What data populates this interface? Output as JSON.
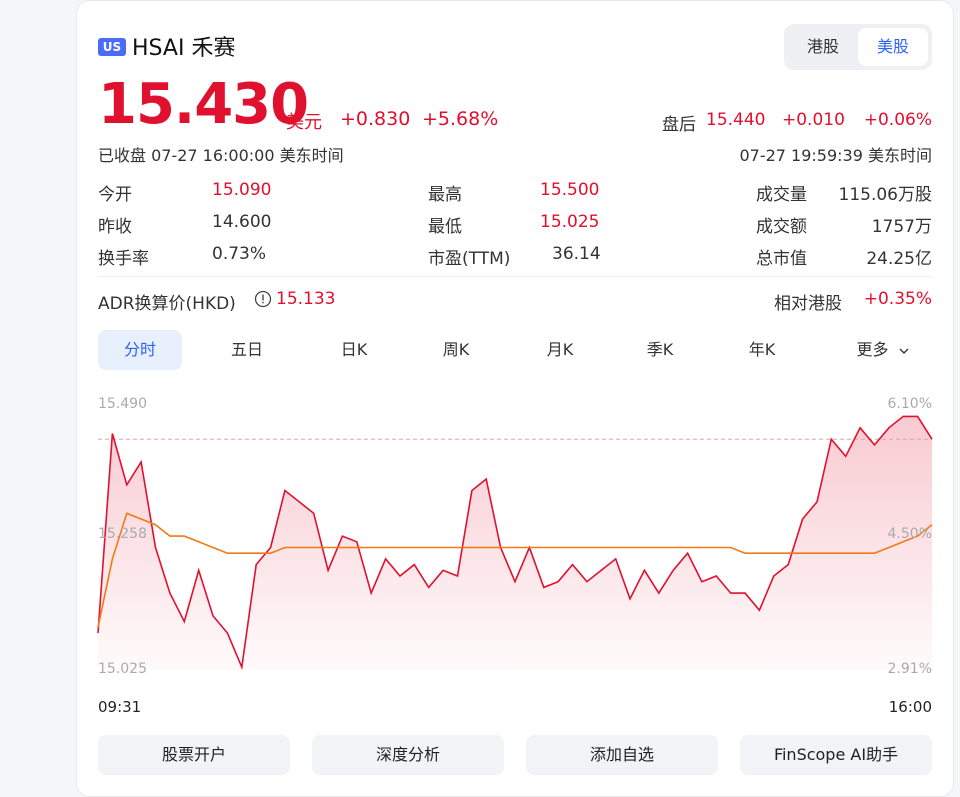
{
  "header": {
    "badge": "US",
    "title": "HSAI 禾赛",
    "market_hk": "港股",
    "market_us": "美股"
  },
  "quote": {
    "price": "15.430",
    "currency": "美元",
    "change": "+0.830",
    "change_pct": "+5.68%",
    "status": "已收盘 07-27 16:00:00 美东时间",
    "after_label": "盘后",
    "after_price": "15.440",
    "after_change": "+0.010",
    "after_pct": "+0.06%",
    "after_time": "07-27 19:59:39 美东时间"
  },
  "stats": {
    "open_label": "今开",
    "open": "15.090",
    "prev_label": "昨收",
    "prev": "14.600",
    "turnover_label": "换手率",
    "turnover": "0.73%",
    "high_label": "最高",
    "high": "15.500",
    "low_label": "最低",
    "low": "15.025",
    "pe_label": "市盈(TTM)",
    "pe": "36.14",
    "volume_label": "成交量",
    "volume": "115.06万股",
    "amount_label": "成交额",
    "amount": "1757万",
    "mcap_label": "总市值",
    "mcap": "24.25亿"
  },
  "adr": {
    "label": "ADR换算价(HKD)",
    "info_icon": "info-circle-icon",
    "value": "15.133",
    "rel_label": "相对港股",
    "rel_value": "+0.35%"
  },
  "tabs": [
    "分时",
    "五日",
    "日K",
    "周K",
    "月K",
    "季K",
    "年K",
    "更多"
  ],
  "actions": [
    "股票开户",
    "深度分析",
    "添加自选",
    "FinScope AI助手"
  ],
  "colors": {
    "up": "#e0102f",
    "avg_line": "#f07a14",
    "accent": "#2f63ff",
    "badge": "#4a6cf7"
  },
  "chart_data": {
    "type": "line",
    "y_left_ticks": [
      "15.490",
      "15.258",
      "15.025"
    ],
    "y_right_ticks": [
      "6.10%",
      "4.50%",
      "2.91%"
    ],
    "x_ticks": [
      "09:31",
      "16:00"
    ],
    "ylim": [
      15.025,
      15.49
    ],
    "reference_line": 15.43,
    "x": [
      "09:31",
      "09:37",
      "09:44",
      "09:51",
      "09:58",
      "10:04",
      "10:11",
      "10:18",
      "10:24",
      "10:31",
      "10:38",
      "10:45",
      "10:51",
      "10:58",
      "11:05",
      "11:11",
      "11:18",
      "11:25",
      "11:31",
      "11:38",
      "11:45",
      "11:52",
      "11:58",
      "12:05",
      "12:12",
      "12:18",
      "12:25",
      "12:32",
      "12:38",
      "12:45",
      "12:52",
      "12:59",
      "13:05",
      "13:12",
      "13:19",
      "13:25",
      "13:32",
      "13:39",
      "13:45",
      "13:52",
      "13:59",
      "14:06",
      "14:12",
      "14:19",
      "14:26",
      "14:32",
      "14:39",
      "14:46",
      "14:52",
      "14:59",
      "15:06",
      "15:13",
      "15:19",
      "15:26",
      "15:33",
      "15:39",
      "15:46",
      "15:53",
      "16:00"
    ],
    "series": [
      {
        "values": [
          15.09,
          15.44,
          15.35,
          15.39,
          15.24,
          15.16,
          15.11,
          15.2,
          15.12,
          15.09,
          15.03,
          15.21,
          15.24,
          15.34,
          15.32,
          15.3,
          15.2,
          15.26,
          15.25,
          15.16,
          15.22,
          15.19,
          15.21,
          15.17,
          15.2,
          15.19,
          15.34,
          15.36,
          15.24,
          15.18,
          15.24,
          15.17,
          15.18,
          15.21,
          15.18,
          15.2,
          15.22,
          15.15,
          15.2,
          15.16,
          15.2,
          15.23,
          15.18,
          15.19,
          15.16,
          15.16,
          15.13,
          15.19,
          15.21,
          15.29,
          15.32,
          15.43,
          15.4,
          15.45,
          15.42,
          15.45,
          15.47,
          15.47,
          15.43
        ]
      },
      {
        "values": [
          15.1,
          15.22,
          15.3,
          15.29,
          15.28,
          15.26,
          15.26,
          15.25,
          15.24,
          15.23,
          15.23,
          15.23,
          15.23,
          15.24,
          15.24,
          15.24,
          15.24,
          15.24,
          15.24,
          15.24,
          15.24,
          15.24,
          15.24,
          15.24,
          15.24,
          15.24,
          15.24,
          15.24,
          15.24,
          15.24,
          15.24,
          15.24,
          15.24,
          15.24,
          15.24,
          15.24,
          15.24,
          15.24,
          15.24,
          15.24,
          15.24,
          15.24,
          15.24,
          15.24,
          15.24,
          15.23,
          15.23,
          15.23,
          15.23,
          15.23,
          15.23,
          15.23,
          15.23,
          15.23,
          15.23,
          15.24,
          15.25,
          15.26,
          15.28
        ]
      }
    ]
  }
}
